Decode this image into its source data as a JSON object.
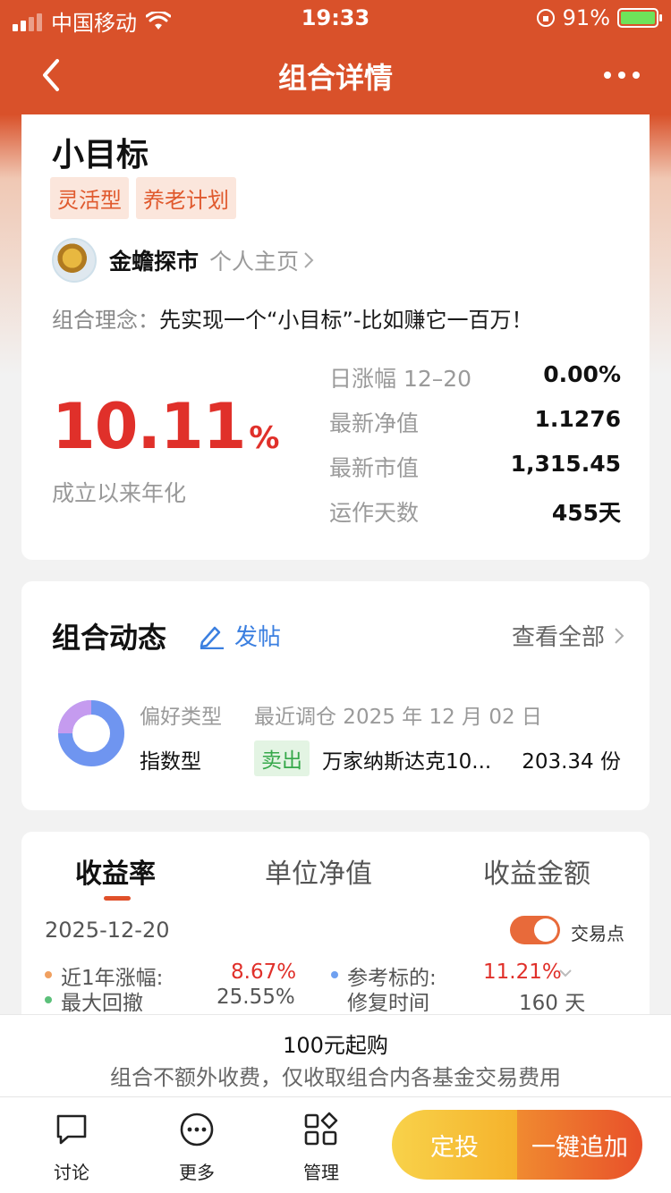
{
  "status_bar": {
    "carrier": "中国移动",
    "time": "19:33",
    "battery": "91%"
  },
  "nav": {
    "title": "组合详情"
  },
  "portfolio": {
    "name": "小目标",
    "tags": [
      "灵活型",
      "养老计划"
    ],
    "author": {
      "name": "金蟾探市",
      "link_label": "个人主页"
    },
    "concept_label": "组合理念：",
    "concept_text": "先实现一个“小目标”-比如赚它一百万！",
    "annualized_value": "10.11",
    "annualized_unit": "%",
    "annualized_label": "成立以来年化",
    "stats": [
      {
        "label": "日涨幅 12–20",
        "value": "0.00%"
      },
      {
        "label": "最新净值",
        "value": "1.1276"
      },
      {
        "label": "最新市值",
        "value": "1,315.45"
      },
      {
        "label": "运作天数",
        "value": "455天"
      }
    ]
  },
  "dynamics": {
    "title": "组合动态",
    "post_label": "发帖",
    "view_all_label": "查看全部",
    "preference_label": "偏好类型",
    "preference_value": "指数型",
    "recent_adjust": "最近调仓 2025 年 12 月 02 日",
    "action_badge": "卖出",
    "fund_name": "万家纳斯达克10...",
    "shares": "203.34 份",
    "donut_colors": [
      "#6f95f0",
      "#c59bef"
    ]
  },
  "performance": {
    "tabs": [
      "收益率",
      "单位净值",
      "收益金额"
    ],
    "active_tab": 0,
    "date": "2025-12-20",
    "toggle_label": "交易点",
    "metrics": {
      "year_change_label": "近1年涨幅:",
      "year_change_value": "8.67%",
      "benchmark_label": "参考标的:",
      "benchmark_value": "11.21%",
      "max_drawdown_label": "最大回撤",
      "max_drawdown_value": "25.55%",
      "recovery_label": "修复时间",
      "recovery_value": "160 天"
    }
  },
  "purchase": {
    "min_amount": "100元起购",
    "fee_note": "组合不额外收费，仅收取组合内各基金交易费用"
  },
  "bottom_bar": {
    "items": [
      {
        "label": "讨论",
        "icon": "chat-icon"
      },
      {
        "label": "更多",
        "icon": "more-icon"
      },
      {
        "label": "管理",
        "icon": "grid-icon"
      }
    ],
    "fixed_invest_label": "定投",
    "add_label": "一键追加"
  },
  "colors": {
    "brand": "#d9512a",
    "red": "#e0302a",
    "green": "#36a84a",
    "blue": "#3b7fe0"
  }
}
